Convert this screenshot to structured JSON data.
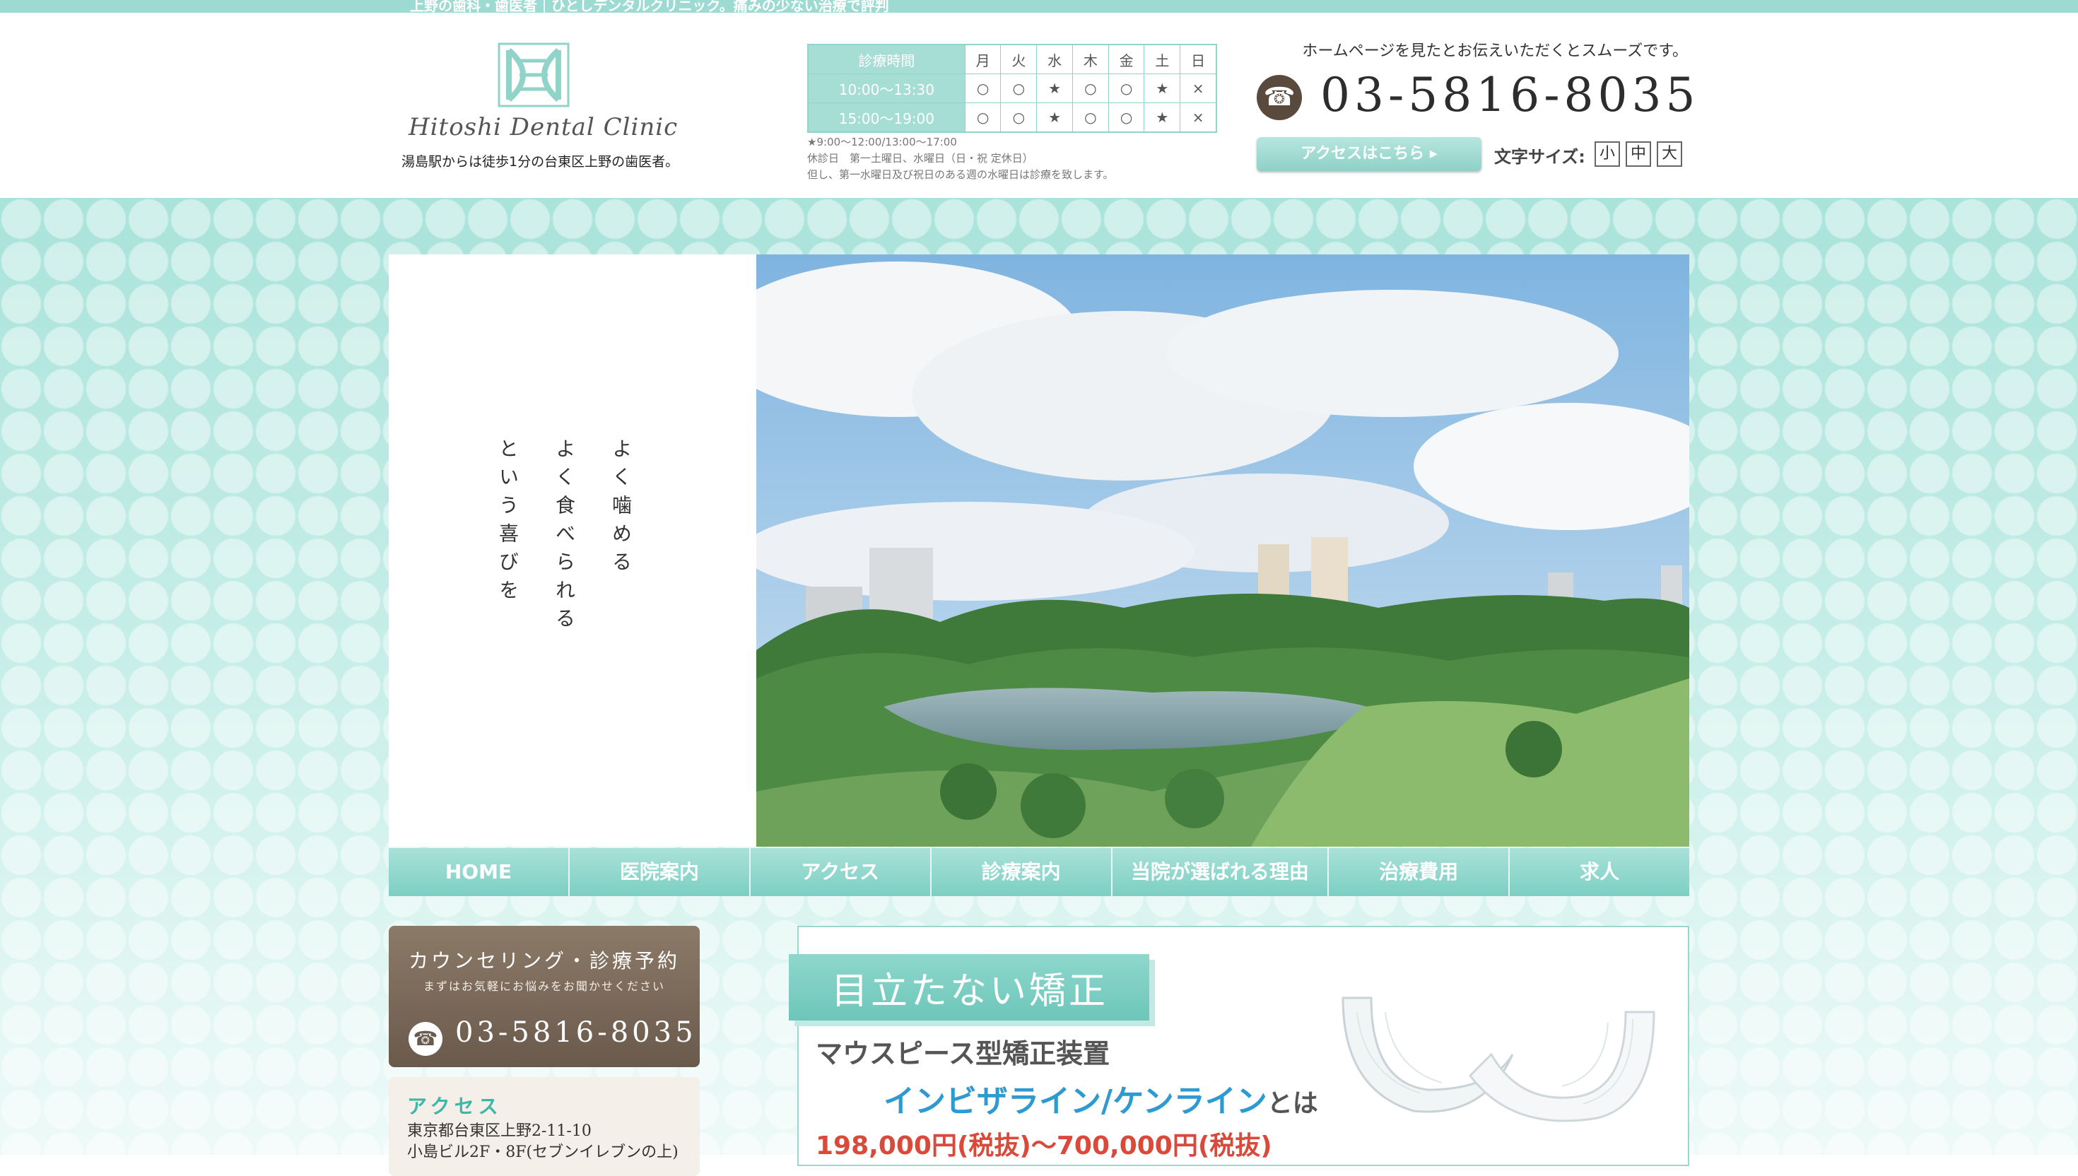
{
  "topbar": {
    "text": "上野の歯科・歯医者｜ひとしデンタルクリニック。痛みの少ない治療で評判"
  },
  "logo": {
    "name": "Hitoshi Dental Clinic",
    "tagline": "湯島駅からは徒歩1分の台東区上野の歯医者。"
  },
  "hours": {
    "header_label": "診療時間",
    "days": [
      "月",
      "火",
      "水",
      "木",
      "金",
      "土",
      "日"
    ],
    "rows": [
      {
        "time": "10:00〜13:30",
        "marks": [
          "○",
          "○",
          "★",
          "○",
          "○",
          "★",
          "×"
        ]
      },
      {
        "time": "15:00〜19:00",
        "marks": [
          "○",
          "○",
          "★",
          "○",
          "○",
          "★",
          "×"
        ]
      }
    ],
    "notes": [
      "★9:00〜12:00/13:00〜17:00",
      "休診日　第一土曜日、水曜日（日・祝 定休日）",
      "但し、第一水曜日及び祝日のある週の水曜日は診療を致します。"
    ]
  },
  "contact": {
    "lead": "ホームページを見たとお伝えいただくとスムーズです。",
    "phone": "03-5816-8035",
    "access_button": "アクセスはこちら ▸",
    "font_size_label": "文字サイズ:",
    "font_sizes": [
      "小",
      "中",
      "大"
    ]
  },
  "hero": {
    "lines": [
      "よく噛める",
      "よく食べられる",
      "という喜びを"
    ]
  },
  "nav": {
    "items": [
      "HOME",
      "医院案内",
      "アクセス",
      "診療案内",
      "当院が選ばれる理由",
      "治療費用",
      "求人"
    ]
  },
  "sidebar": {
    "reserve_title": "カウンセリング・診療予約",
    "reserve_sub": "まずはお気軽にお悩みをお聞かせください",
    "reserve_phone": "03-5816-8035",
    "access_title": "アクセス",
    "access_address": [
      "東京都台東区上野2-11-10",
      "小島ビル2F・8F(セブンイレブンの上)"
    ]
  },
  "main": {
    "ribbon": "目立たない矯正",
    "device": "マウスピース型矯正装置",
    "brand": "インビザライン/ケンライン",
    "brand_suffix": "とは",
    "price": "198,000円(税抜)〜700,000円(税抜)"
  },
  "colors": {
    "mint": "#9ddbd2",
    "brown": "#6a5a4c",
    "accent_blue": "#2e9bd0",
    "price_red": "#d94a3a"
  }
}
